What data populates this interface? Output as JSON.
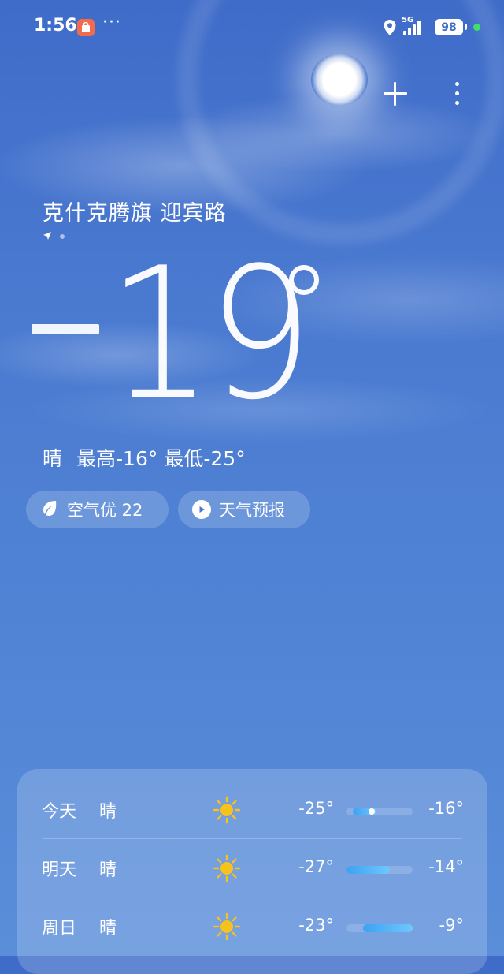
{
  "status_bar": {
    "time": "1:56",
    "more": "···",
    "network": "5G",
    "battery": "98"
  },
  "location": {
    "name": "克什克腾旗 迎宾路"
  },
  "current": {
    "temperature": "-19",
    "minus": "—",
    "digits": "19",
    "condition": "晴",
    "high_label": "最高-16°",
    "low_label": "最低-25°"
  },
  "pills": {
    "aqi": "空气优 22",
    "forecast": "天气预报"
  },
  "forecast": [
    {
      "day": "今天",
      "condition": "晴",
      "icon": "sun-icon",
      "low": "-25°",
      "high": "-16°",
      "range_start": 0.1,
      "range_end": 0.45,
      "now": 0.38
    },
    {
      "day": "明天",
      "condition": "晴",
      "icon": "sun-icon",
      "low": "-27°",
      "high": "-14°",
      "range_start": 0.0,
      "range_end": 0.65,
      "now": null
    },
    {
      "day": "周日",
      "condition": "晴",
      "icon": "sun-icon",
      "low": "-23°",
      "high": "-9°",
      "range_start": 0.25,
      "range_end": 1.0,
      "now": null
    }
  ],
  "colors": {
    "sky_top": "#3f6cc9",
    "sky_bottom": "#5a8ed9",
    "range_fill": "#3ca2f3",
    "sun_icon": "#f7c21c",
    "charge_dot": "#3ee06a",
    "notification_app": "#f36b4c"
  }
}
